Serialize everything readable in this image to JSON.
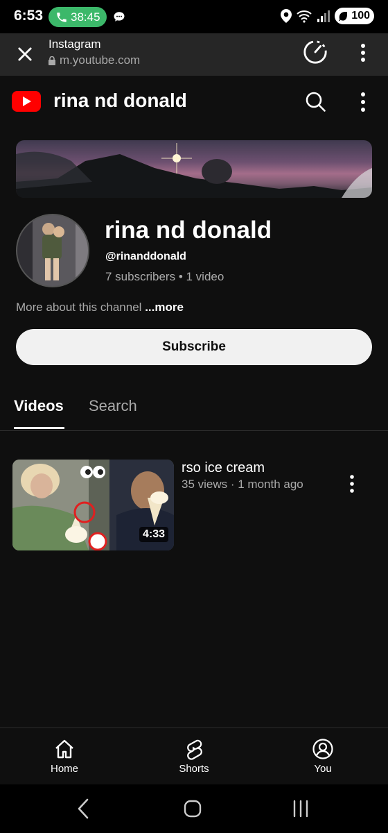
{
  "status_bar": {
    "time": "6:53",
    "call_timer": "38:45",
    "battery": "100"
  },
  "browser": {
    "title": "Instagram",
    "url": "m.youtube.com"
  },
  "header": {
    "channel_title": "rina nd donald"
  },
  "channel": {
    "name": "rina nd donald",
    "handle": "@rinanddonald",
    "stats": "7 subscribers • 1 video",
    "about_text": "More about this channel",
    "more_label": "...more",
    "subscribe_label": "Subscribe"
  },
  "tabs": [
    {
      "label": "Videos",
      "active": true
    },
    {
      "label": "Search",
      "active": false
    }
  ],
  "videos": [
    {
      "title": "rso ice cream",
      "meta": "35 views · 1 month ago",
      "duration": "4:33"
    }
  ],
  "bottom_nav": [
    {
      "label": "Home",
      "icon": "home-icon"
    },
    {
      "label": "Shorts",
      "icon": "shorts-icon"
    },
    {
      "label": "You",
      "icon": "account-icon"
    }
  ],
  "colors": {
    "background": "#0f0f0f",
    "call_green": "#3cb86a",
    "youtube_red": "#ff0000",
    "muted_text": "#aaaaaa"
  }
}
